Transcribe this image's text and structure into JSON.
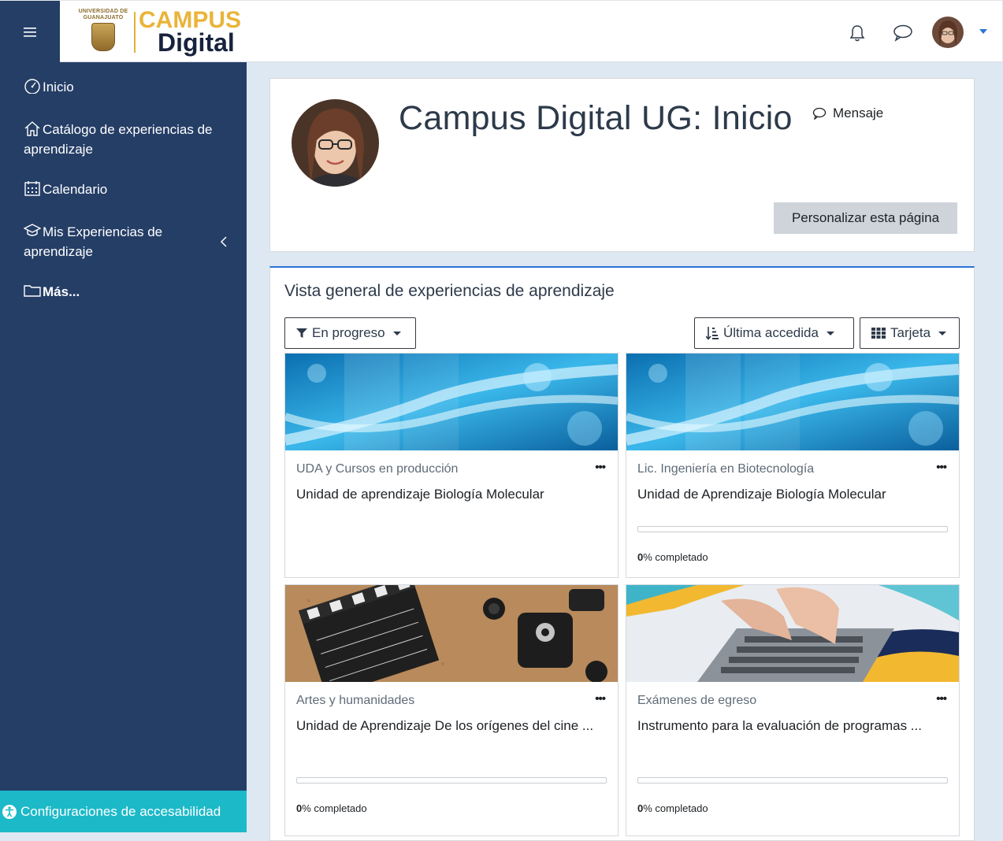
{
  "brand": {
    "university": "UNIVERSIDAD DE GUANAJUATO",
    "campus": "CAMPUS",
    "digital": "Digital"
  },
  "navbar": {
    "menu_icon": "hamburger-icon",
    "notification_icon": "bell-icon",
    "messages_icon": "chat-bubble-icon",
    "user_menu_icon": "caret-down-icon"
  },
  "sidebar": {
    "items": [
      {
        "label": "Inicio",
        "icon": "dashboard-gauge-icon"
      },
      {
        "label": "Catálogo de experiencias de aprendizaje",
        "icon": "home-icon"
      },
      {
        "label": "Calendario",
        "icon": "calendar-icon"
      },
      {
        "label": "Mis Experiencias de aprendizaje",
        "icon": "graduation-cap-icon"
      },
      {
        "label": "Más...",
        "icon": "folder-icon"
      }
    ],
    "accessibility_label": "Configuraciones de accesabilidad"
  },
  "header": {
    "title": "Campus Digital UG: Inicio",
    "message_label": "Mensaje",
    "customize_label": "Personalizar esta página"
  },
  "overview": {
    "title": "Vista general de experiencias de aprendizaje",
    "filter_label": "En progreso",
    "sort_label": "Última accedida",
    "view_label": "Tarjeta",
    "menu_dots": "•••",
    "courses": [
      {
        "category": "UDA y Cursos en producción",
        "name": "Unidad de aprendizaje Biología Molecular",
        "image": "dna",
        "progress": null
      },
      {
        "category": "Lic. Ingeniería en Biotecnología",
        "name": "Unidad de Aprendizaje Biología Molecular",
        "image": "dna",
        "progress": 0,
        "progress_label": "0",
        "progress_suffix": "% completado"
      },
      {
        "category": "Artes y humanidades",
        "name": "Unidad de Aprendizaje De los orígenes del cine ...",
        "image": "film",
        "progress": 0,
        "progress_label": "0",
        "progress_suffix": "% completado"
      },
      {
        "category": "Exámenes de egreso",
        "name": "Instrumento para la evaluación de programas ...",
        "image": "laptop",
        "progress": 0,
        "progress_label": "0",
        "progress_suffix": "% completado"
      }
    ]
  },
  "colors": {
    "sidebar_bg": "#253e66",
    "accent": "#2a72d6",
    "accessibility_bg": "#1cb9c8",
    "brand_gold": "#e9b43a",
    "brand_navy": "#17233d"
  }
}
